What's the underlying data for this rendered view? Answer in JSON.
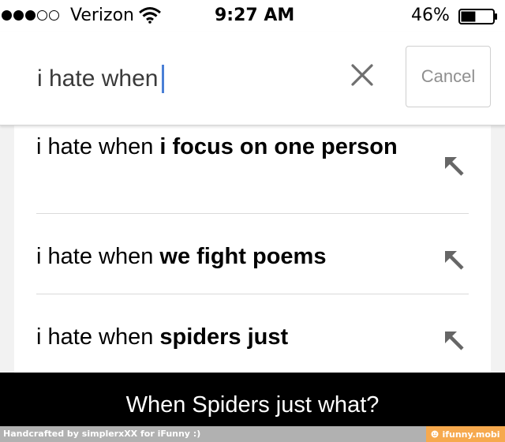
{
  "status_bar": {
    "carrier": "Verizon",
    "time": "9:27 AM",
    "battery_percent": "46%",
    "battery_level": 0.46,
    "signal_bars_filled": 3,
    "signal_bars_total": 5
  },
  "search": {
    "query": "i hate when",
    "cancel_label": "Cancel",
    "clear_icon": "close-icon",
    "caret_color": "#4a7fd6"
  },
  "suggestions": [
    {
      "prefix": "i hate when ",
      "completion": "i focus on one person",
      "icon": "fill-arrow-icon"
    },
    {
      "prefix": "i hate when ",
      "completion": "we fight poems",
      "icon": "fill-arrow-icon"
    },
    {
      "prefix": "i hate when ",
      "completion": "spiders just",
      "icon": "fill-arrow-icon"
    }
  ],
  "caption": {
    "text": "When Spiders just what?"
  },
  "footer": {
    "credit": "Handcrafted by simplerxXX for iFunny :)",
    "site": "ifunny.mobi",
    "accent_color": "#f6a94e"
  }
}
